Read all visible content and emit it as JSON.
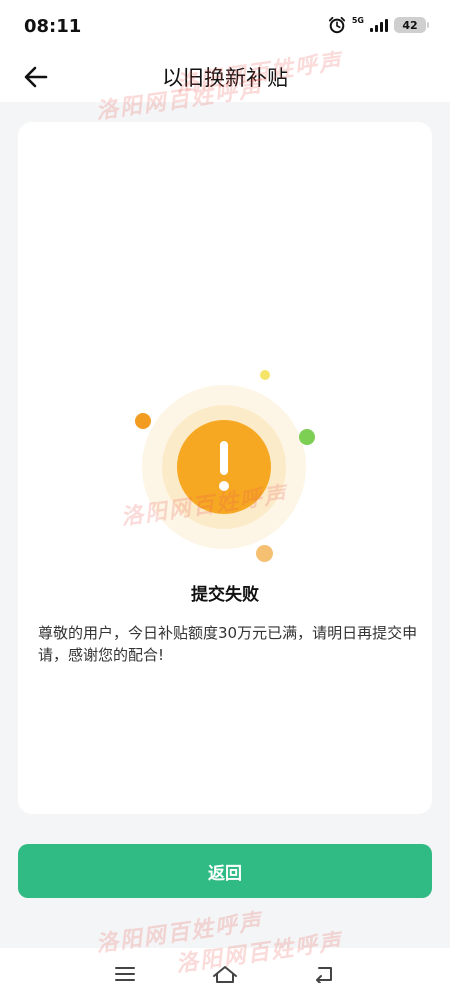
{
  "status_bar": {
    "time": "08:11",
    "network": "5G",
    "battery": "42",
    "icons": [
      "alarm-icon",
      "signal-icon",
      "battery-icon"
    ]
  },
  "header": {
    "title": "以旧换新补贴",
    "back_icon": "arrow-left-icon"
  },
  "result": {
    "icon": "exclamation-icon",
    "title": "提交失败",
    "message": "尊敬的用户，今日补贴额度30万元已满，请明日再提交申请，感谢您的配合!"
  },
  "actions": {
    "return_label": "返回"
  },
  "watermark": {
    "text": "洛阳网百姓呼声"
  },
  "nav_bar": {
    "icons": [
      "menu-icon",
      "home-icon",
      "back-icon"
    ]
  },
  "colors": {
    "accent": "#31bb84",
    "warning": "#f7a823",
    "background": "#f4f5f7"
  }
}
